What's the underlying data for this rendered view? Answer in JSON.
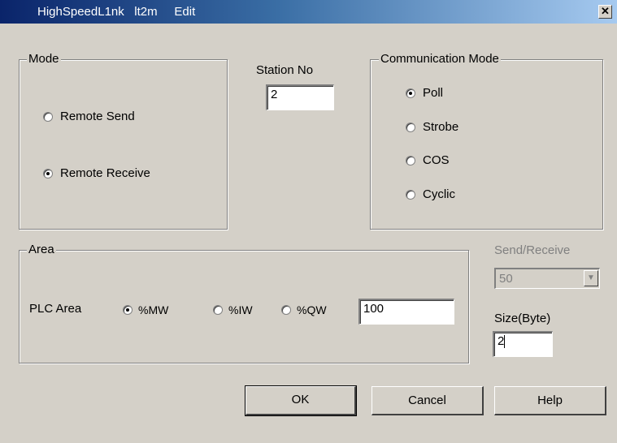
{
  "window": {
    "title": "HighSpeedL1nk   lt2m     Edit",
    "close": "✕"
  },
  "mode": {
    "legend": "Mode",
    "options": [
      {
        "label": "Remote Send",
        "checked": false
      },
      {
        "label": "Remote Receive",
        "checked": true
      }
    ]
  },
  "station": {
    "label": "Station No",
    "value": "2"
  },
  "comm_mode": {
    "legend": "Communication Mode",
    "options": [
      {
        "label": "Poll",
        "checked": true
      },
      {
        "label": "Strobe",
        "checked": false
      },
      {
        "label": "COS",
        "checked": false
      },
      {
        "label": "Cyclic",
        "checked": false
      }
    ]
  },
  "area": {
    "legend": "Area",
    "plc_label": "PLC Area",
    "options": [
      {
        "label": "%MW",
        "checked": true
      },
      {
        "label": "%IW",
        "checked": false
      },
      {
        "label": "%QW",
        "checked": false
      }
    ],
    "value": "100"
  },
  "send_receive": {
    "label": "Send/Receive",
    "value": "50",
    "enabled": false
  },
  "size": {
    "label": "Size(Byte)",
    "value": "2"
  },
  "buttons": {
    "ok": "OK",
    "cancel": "Cancel",
    "help": "Help"
  }
}
